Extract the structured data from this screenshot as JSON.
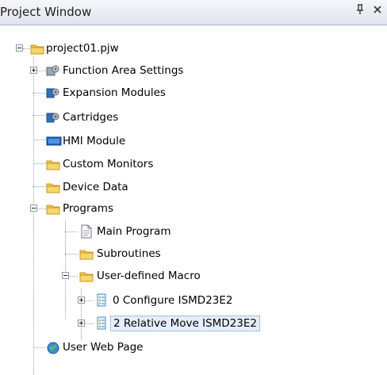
{
  "window": {
    "title": "Project Window",
    "pin_glyph": "q",
    "close_glyph": "×"
  },
  "tree": {
    "root": {
      "label": "project01.pjw",
      "icon": "folder-icon",
      "expanded": true
    },
    "items": [
      {
        "label": "Function Area Settings",
        "icon": "settings-gears-icon",
        "expandable": true,
        "expanded": false
      },
      {
        "label": "Expansion Modules",
        "icon": "gear-module-icon"
      },
      {
        "label": "Cartridges",
        "icon": "gear-module-icon"
      },
      {
        "label": "HMI Module",
        "icon": "hmi-display-icon"
      },
      {
        "label": "Custom Monitors",
        "icon": "folder-icon"
      },
      {
        "label": "Device Data",
        "icon": "folder-icon"
      },
      {
        "label": "Programs",
        "icon": "folder-icon",
        "expandable": true,
        "expanded": true,
        "children": [
          {
            "label": "Main Program",
            "icon": "document-icon"
          },
          {
            "label": "Subroutines",
            "icon": "folder-icon"
          },
          {
            "label": "User-defined Macro",
            "icon": "folder-icon",
            "expandable": true,
            "expanded": true,
            "children": [
              {
                "label": "0 Configure ISMD23E2",
                "icon": "macro-list-icon",
                "expandable": true,
                "expanded": false
              },
              {
                "label": "2 Relative Move ISMD23E2",
                "icon": "macro-list-icon",
                "expandable": true,
                "expanded": false,
                "selected": true
              }
            ]
          }
        ]
      },
      {
        "label": "User Web Page",
        "icon": "globe-icon"
      }
    ]
  },
  "colors": {
    "folder": "#f2c64a",
    "selection_bg": "#e7eefb",
    "selection_border": "#6d8fc0",
    "title_bg": "#dfe5ee"
  }
}
